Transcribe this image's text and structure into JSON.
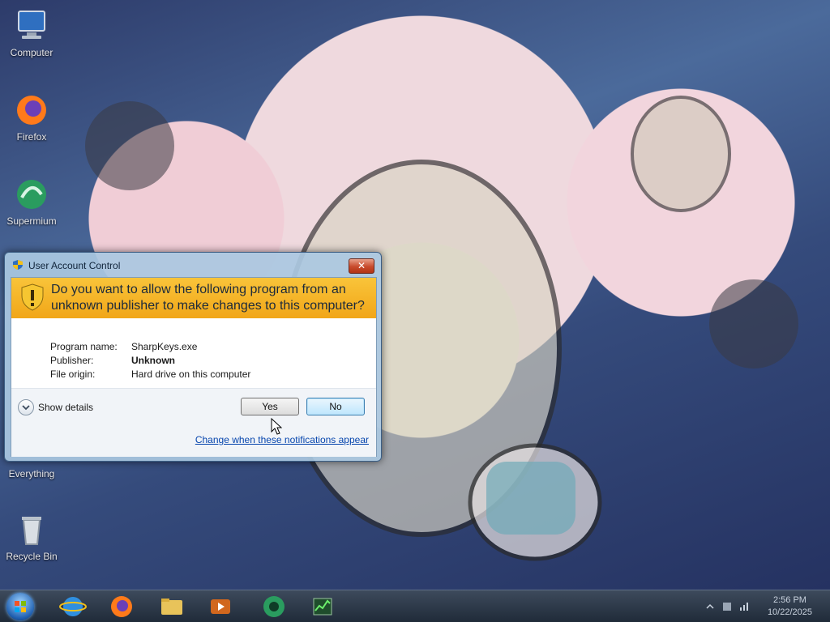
{
  "desktop": {
    "icons": [
      {
        "label": "Computer"
      },
      {
        "label": "Firefox"
      },
      {
        "label": "Supermium"
      },
      {
        "label": "Everything"
      },
      {
        "label": "Recycle Bin"
      }
    ]
  },
  "dialog": {
    "title": "User Account Control",
    "close_glyph": "✕",
    "question": "Do you want to allow the following program from an unknown publisher to make changes to this computer?",
    "details": [
      {
        "label": "Program name:",
        "value": "SharpKeys.exe",
        "bold": false
      },
      {
        "label": "Publisher:",
        "value": "Unknown",
        "bold": true
      },
      {
        "label": "File origin:",
        "value": "Hard drive on this computer",
        "bold": false
      }
    ],
    "show_details_label": "Show details",
    "yes_label": "Yes",
    "no_label": "No",
    "change_link": "Change when these notifications appear"
  },
  "taskbar": {
    "pinned": [
      "internet-explorer",
      "firefox",
      "file-explorer",
      "media-player",
      "supermium",
      "task-manager"
    ],
    "clock_time": "2:56 PM",
    "clock_date": "10/22/2025"
  },
  "colors": {
    "banner": "#f1a618",
    "link": "#0645ad",
    "close_button": "#c84a2b"
  }
}
